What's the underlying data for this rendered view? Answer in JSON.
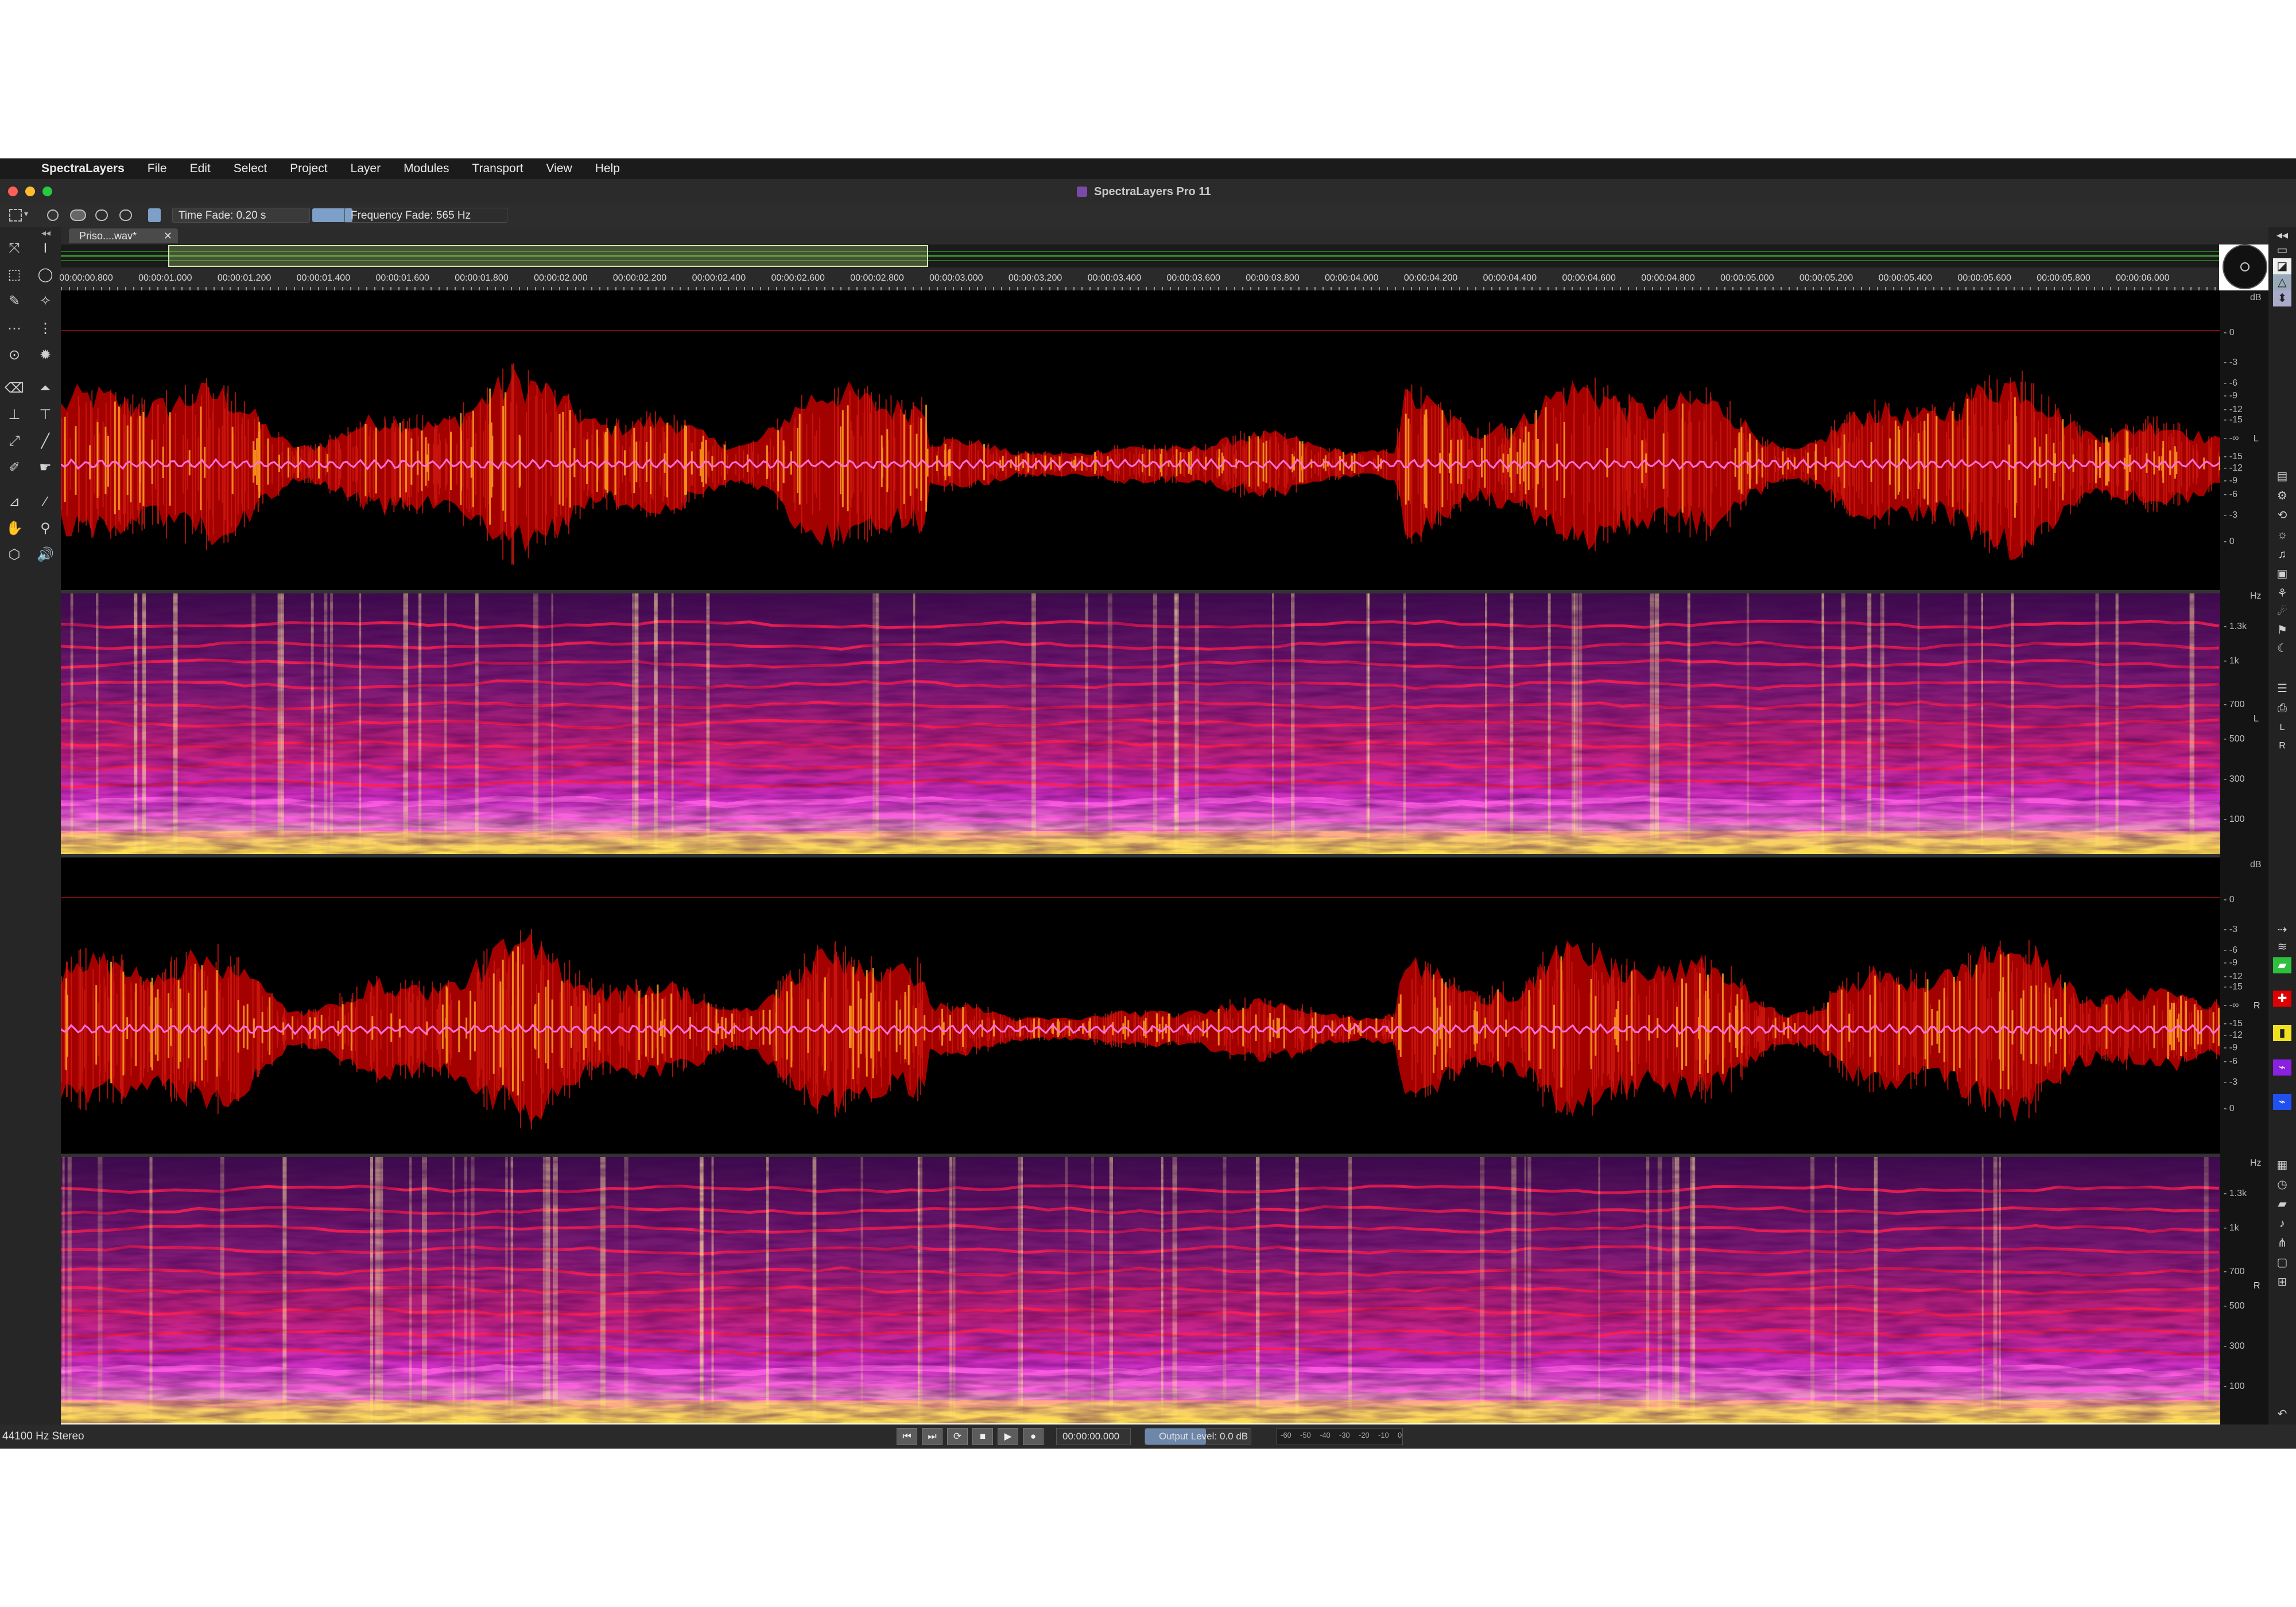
{
  "menubar": {
    "app_name": "SpectraLayers",
    "items": [
      "File",
      "Edit",
      "Select",
      "Project",
      "Layer",
      "Modules",
      "Transport",
      "View",
      "Help"
    ]
  },
  "window": {
    "title": "SpectraLayers Pro 11",
    "colors": {
      "close": "#ff5f57",
      "minimize": "#febc2e",
      "zoom": "#28c840"
    }
  },
  "options": {
    "time_fade": "Time Fade: 0.20 s",
    "frequency_fade": "Frequency Fade: 565 Hz"
  },
  "tab": {
    "file_name": "Priso....wav*",
    "close_glyph": "✕"
  },
  "ruler": {
    "labels": [
      "00:00:00.800",
      "00:00:01.000",
      "00:00:01.200",
      "00:00:01.400",
      "00:00:01.600",
      "00:00:01.800",
      "00:00:02.000",
      "00:00:02.200",
      "00:00:02.400",
      "00:00:02.600",
      "00:00:02.800",
      "00:00:03.000",
      "00:00:03.200",
      "00:00:03.400",
      "00:00:03.600",
      "00:00:03.800",
      "00:00:04.000",
      "00:00:04.200",
      "00:00:04.400",
      "00:00:04.600",
      "00:00:04.800",
      "00:00:05.000",
      "00:00:05.200",
      "00:00:05.400",
      "00:00:05.600",
      "00:00:05.800",
      "00:00:06.000"
    ]
  },
  "waveform_scale": {
    "unit": "dB",
    "labels": [
      "0",
      "-3",
      "-6",
      "-9",
      "-12",
      "-15",
      "-∞",
      "-15",
      "-12",
      "-9",
      "-6",
      "-3",
      "0"
    ]
  },
  "spectrum_scale": {
    "unit": "Hz",
    "labels": [
      "1.3k",
      "1k",
      "700",
      "500",
      "300",
      "100"
    ]
  },
  "channels": [
    {
      "name": "L"
    },
    {
      "name": "R"
    }
  ],
  "status": {
    "format": "44100 Hz Stereo",
    "time": "00:00:00.000",
    "output_label": "Output Level:",
    "output_value": "0.0 dB",
    "meter_labels": [
      "-60",
      "-50",
      "-40",
      "-30",
      "-20",
      "-10",
      "0"
    ]
  },
  "colors": {
    "waveform_envelope": "#a30000",
    "waveform_core": "#ff70e0",
    "waveform_peaks": "#ffa020",
    "spectro_background": "#5a0a5e",
    "spectro_harmonics": "#ff2050",
    "spectro_low": "#ffe040"
  }
}
